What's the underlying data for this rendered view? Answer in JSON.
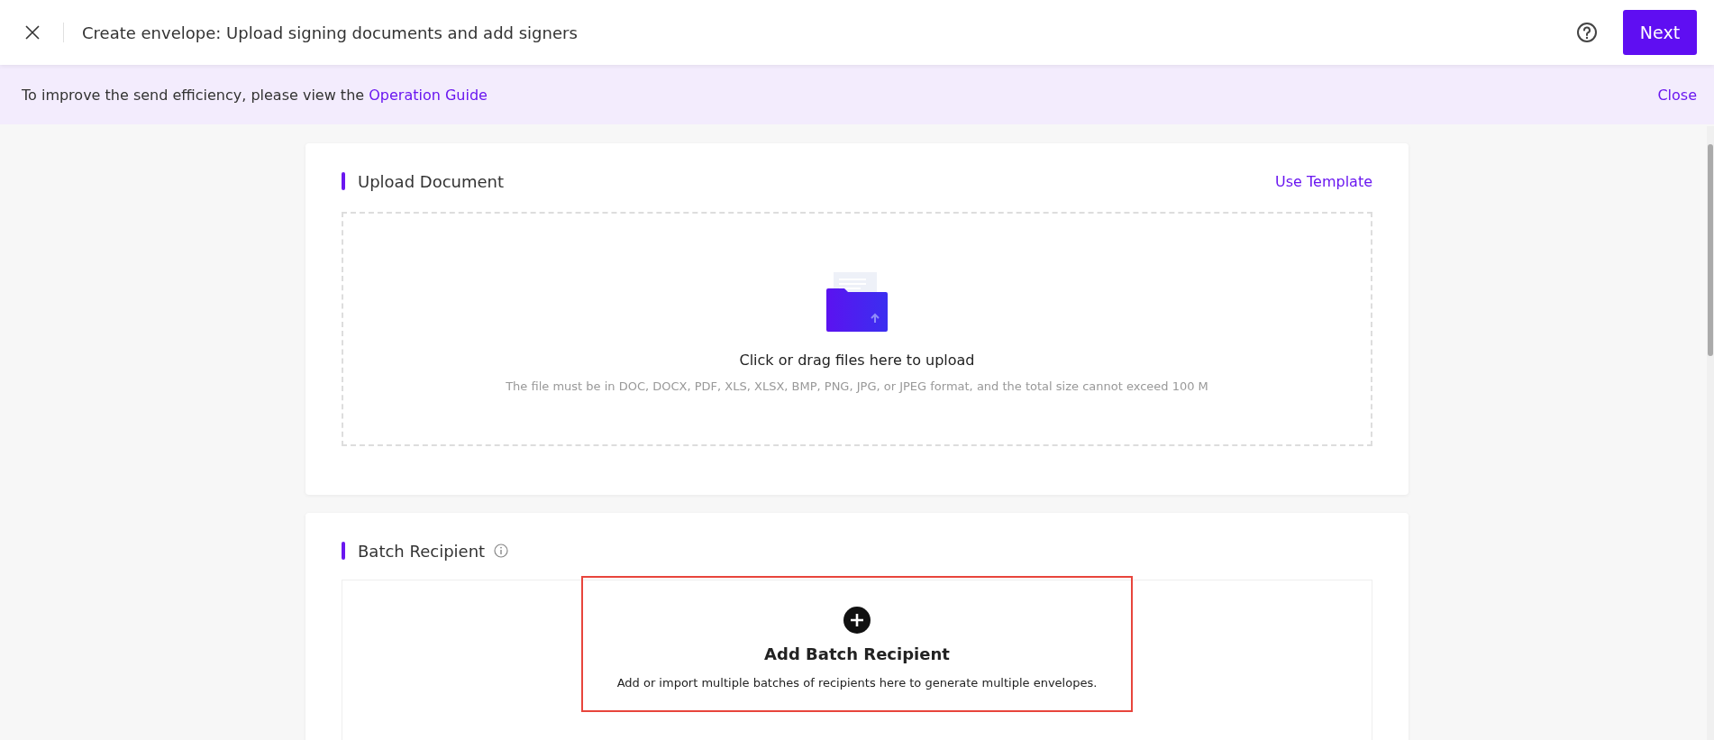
{
  "header": {
    "title": "Create envelope: Upload signing documents and add signers",
    "next_button": "Next"
  },
  "banner": {
    "text": "To improve the send efficiency, please view the",
    "link": "Operation Guide",
    "close": "Close"
  },
  "upload_section": {
    "title": "Upload Document",
    "action": "Use Template",
    "dropzone": {
      "prompt": "Click or drag files here to upload",
      "hint": "The file must be in DOC, DOCX, PDF, XLS, XLSX, BMP, PNG, JPG, or JPEG format, and the total size cannot exceed 100 M"
    }
  },
  "batch_section": {
    "title": "Batch Recipient",
    "add": {
      "title": "Add Batch Recipient",
      "description": "Add or import multiple batches of recipients here to generate multiple envelopes.",
      "highlighted": true
    }
  }
}
